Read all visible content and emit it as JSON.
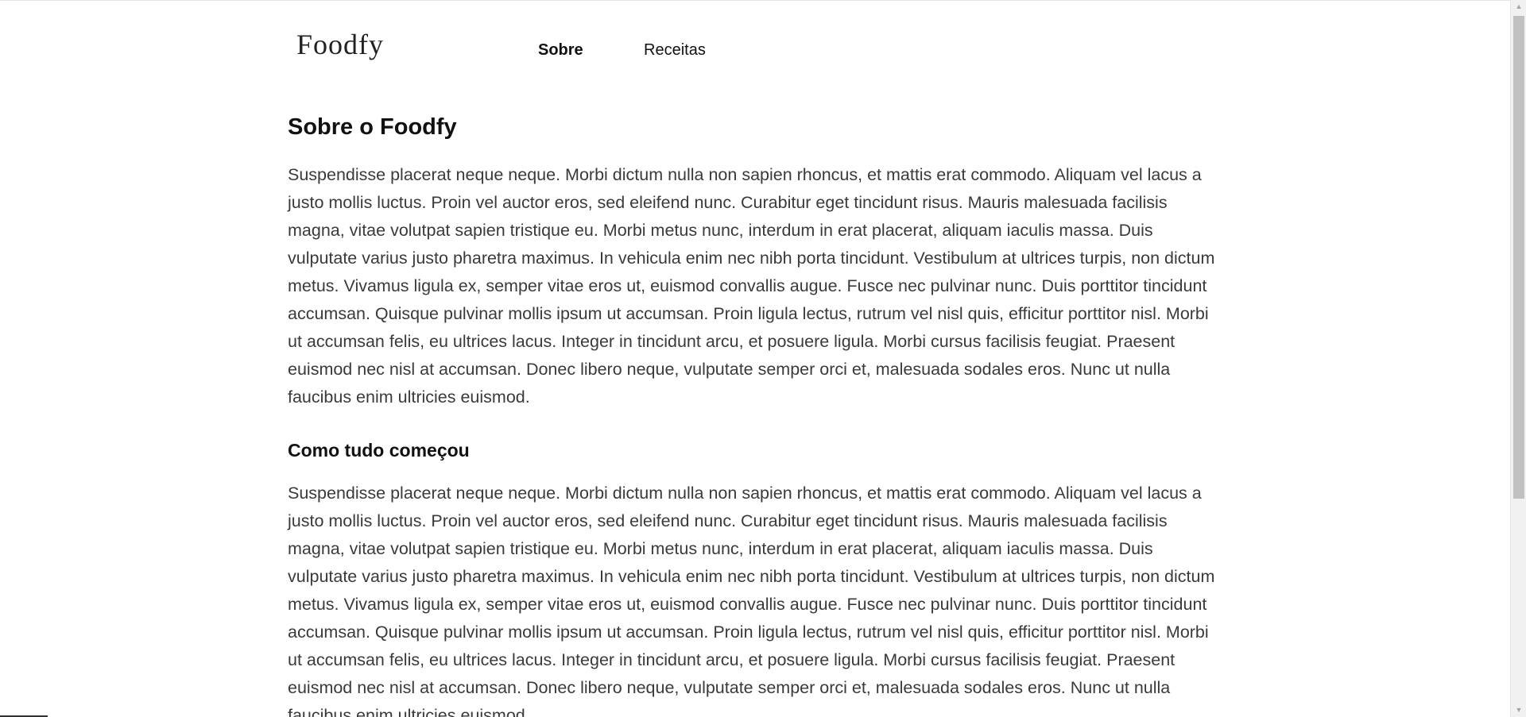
{
  "header": {
    "logo": "Foodfy",
    "nav": [
      {
        "label": "Sobre",
        "active": true
      },
      {
        "label": "Receitas",
        "active": false
      }
    ]
  },
  "main": {
    "title": "Sobre o Foodfy",
    "intro_paragraph": "Suspendisse placerat neque neque. Morbi dictum nulla non sapien rhoncus, et mattis erat commodo. Aliquam vel lacus a justo mollis luctus. Proin vel auctor eros, sed eleifend nunc. Curabitur eget tincidunt risus. Mauris malesuada facilisis magna, vitae volutpat sapien tristique eu. Morbi metus nunc, interdum in erat placerat, aliquam iaculis massa. Duis vulputate varius justo pharetra maximus. In vehicula enim nec nibh porta tincidunt. Vestibulum at ultrices turpis, non dictum metus. Vivamus ligula ex, semper vitae eros ut, euismod convallis augue. Fusce nec pulvinar nunc. Duis porttitor tincidunt accumsan. Quisque pulvinar mollis ipsum ut accumsan. Proin ligula lectus, rutrum vel nisl quis, efficitur porttitor nisl. Morbi ut accumsan felis, eu ultrices lacus. Integer in tincidunt arcu, et posuere ligula. Morbi cursus facilisis feugiat. Praesent euismod nec nisl at accumsan. Donec libero neque, vulputate semper orci et, malesuada sodales eros. Nunc ut nulla faucibus enim ultricies euismod.",
    "section": {
      "title": "Como tudo começou",
      "paragraph": "Suspendisse placerat neque neque. Morbi dictum nulla non sapien rhoncus, et mattis erat commodo. Aliquam vel lacus a justo mollis luctus. Proin vel auctor eros, sed eleifend nunc. Curabitur eget tincidunt risus. Mauris malesuada facilisis magna, vitae volutpat sapien tristique eu. Morbi metus nunc, interdum in erat placerat, aliquam iaculis massa. Duis vulputate varius justo pharetra maximus. In vehicula enim nec nibh porta tincidunt. Vestibulum at ultrices turpis, non dictum metus. Vivamus ligula ex, semper vitae eros ut, euismod convallis augue. Fusce nec pulvinar nunc. Duis porttitor tincidunt accumsan. Quisque pulvinar mollis ipsum ut accumsan. Proin ligula lectus, rutrum vel nisl quis, efficitur porttitor nisl. Morbi ut accumsan felis, eu ultrices lacus. Integer in tincidunt arcu, et posuere ligula. Morbi cursus facilisis feugiat. Praesent euismod nec nisl at accumsan. Donec libero neque, vulputate semper orci et, malesuada sodales eros. Nunc ut nulla faucibus enim ultricies euismod."
    }
  },
  "icons": {
    "scroll_up": "scroll-up-arrow-icon",
    "scroll_down": "scroll-down-arrow-icon"
  },
  "colors": {
    "text_primary": "#111111",
    "text_body": "#3a3a3a",
    "background": "#ffffff"
  }
}
